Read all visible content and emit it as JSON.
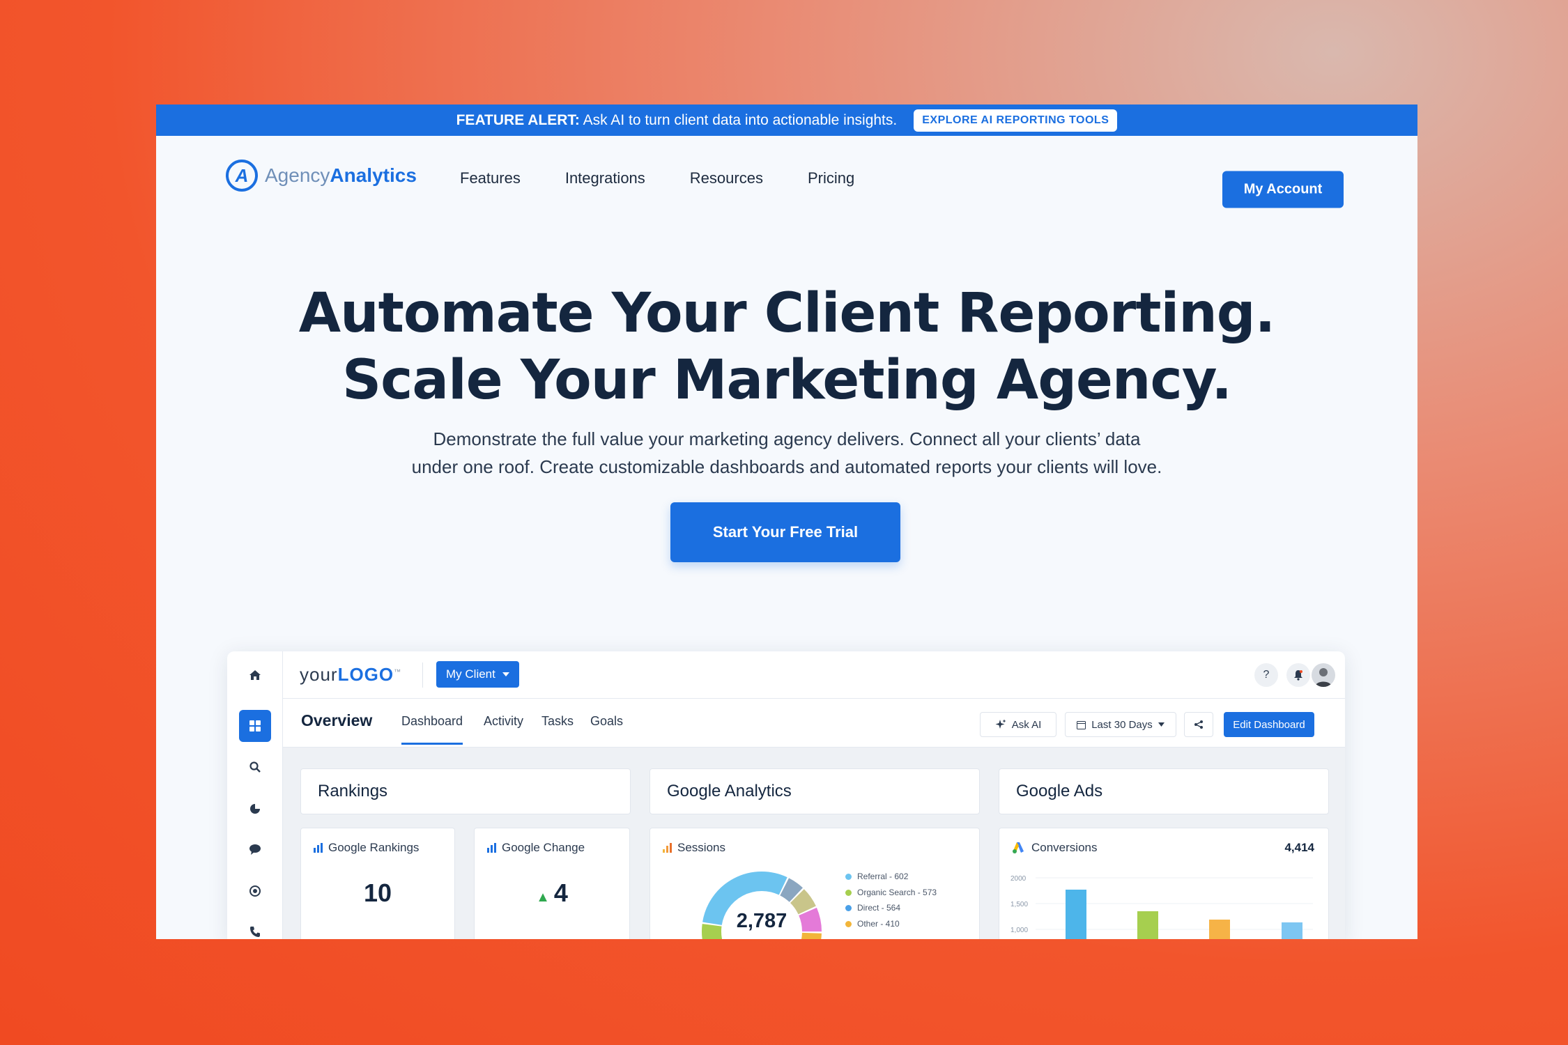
{
  "banner": {
    "alert_label": "FEATURE ALERT:",
    "alert_text": "Ask AI to turn client data into actionable insights.",
    "cta": "EXPLORE AI REPORTING TOOLS"
  },
  "nav": {
    "logo_left": "Agency",
    "logo_right": "Analytics",
    "items": [
      "Features",
      "Integrations",
      "Resources",
      "Pricing"
    ],
    "account": "My Account"
  },
  "hero": {
    "title_line1": "Automate Your Client Reporting.",
    "title_line2": "Scale Your Marketing Agency.",
    "sub_line1": "Demonstrate the full value your marketing agency delivers. Connect all your clients’ data",
    "sub_line2": "under one roof. Create customizable dashboards and automated reports your clients will love.",
    "cta": "Start Your Free Trial"
  },
  "dashboard": {
    "logo_a": "your",
    "logo_b": "LOGO",
    "logo_tm": "™",
    "client_button": "My Client",
    "help_glyph": "?",
    "overview": "Overview",
    "tabs": [
      "Dashboard",
      "Activity",
      "Tasks",
      "Goals"
    ],
    "ask_ai": "Ask AI",
    "date_range": "Last 30 Days",
    "edit": "Edit Dashboard",
    "sections": [
      "Rankings",
      "Google Analytics",
      "Google Ads"
    ],
    "cards": {
      "rankings_title": "Google Rankings",
      "rankings_value": "10",
      "change_title": "Google Change",
      "change_value": "4",
      "sessions_title": "Sessions",
      "sessions_total": "2,787",
      "sessions_legend": [
        "Referral - 602",
        "Organic Search - 573",
        "Direct - 564",
        "Other - 410"
      ],
      "conversions_title": "Conversions",
      "conversions_total": "4,414",
      "conversions_ticks": [
        "2000",
        "1,500",
        "1,000"
      ]
    },
    "colors": {
      "brand": "#1b6fe0",
      "legend": [
        "#6cc4f0",
        "#a6cf4f",
        "#4aa0e8",
        "#f2b53a"
      ],
      "bars": [
        "#4db5ea",
        "#a6cf4f",
        "#f6b347",
        "#7dc6f2"
      ]
    }
  },
  "icons": [
    "home-icon",
    "grid-icon",
    "search-icon",
    "pie-chart-icon",
    "chat-icon",
    "target-icon",
    "phone-icon",
    "sparkle-icon",
    "calendar-icon",
    "share-icon",
    "bell-icon",
    "help-icon"
  ]
}
